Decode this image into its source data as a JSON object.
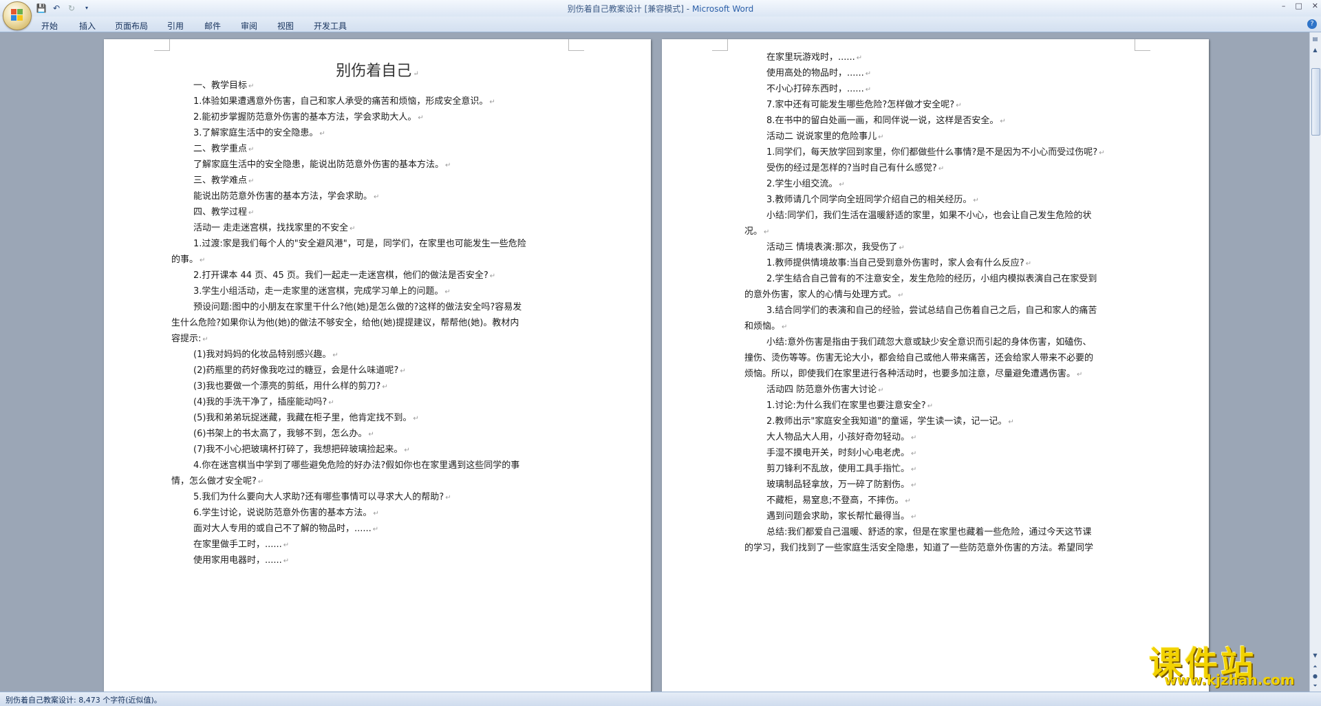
{
  "window": {
    "title": "别伤着自己教案设计 [兼容模式]",
    "title_sep": " - ",
    "app_name": "Microsoft Word"
  },
  "quick_access": {
    "save": "save-icon",
    "undo": "undo-icon",
    "redo": "redo-icon",
    "customize": "dropdown-icon"
  },
  "ribbon_tabs": [
    "开始",
    "插入",
    "页面布局",
    "引用",
    "邮件",
    "审阅",
    "视图",
    "开发工具"
  ],
  "left_page": {
    "title": "别伤着自己",
    "paragraphs": [
      "一、教学目标",
      "1.体验如果遭遇意外伤害，自己和家人承受的痛苦和烦恼，形成安全意识。",
      "2.能初步掌握防范意外伤害的基本方法，学会求助大人。",
      "3.了解家庭生活中的安全隐患。",
      "二、教学重点",
      "了解家庭生活中的安全隐患，能说出防范意外伤害的基本方法。",
      "三、教学难点",
      "能说出防范意外伤害的基本方法，学会求助。",
      "四、教学过程",
      "活动一 走走迷宫棋，找找家里的不安全",
      "1.过渡:家是我们每个人的\"安全避风港\"，可是，同学们，在家里也可能发生一些危险",
      "的事。",
      "2.打开课本 44 页、45 页。我们一起走一走迷宫棋，他们的做法是否安全?",
      "3.学生小组活动，走一走家里的迷宫棋，完成学习单上的问题。",
      "预设问题:图中的小朋友在家里干什么?他(她)是怎么做的?这样的做法安全吗?容易发",
      "生什么危险?如果你认为他(她)的做法不够安全，给他(她)提提建议，帮帮他(她)。教材内",
      "容提示:",
      "(1)我对妈妈的化妆品特别感兴趣。",
      "(2)药瓶里的药好像我吃过的糖豆，会是什么味道呢?",
      "(3)我也要做一个漂亮的剪纸，用什么样的剪刀?",
      "(4)我的手洗干净了，插座能动吗?",
      "(5)我和弟弟玩捉迷藏，我藏在柜子里，他肯定找不到。",
      "(6)书架上的书太高了，我够不到，怎么办。",
      "(7)我不小心把玻璃杯打碎了，我想把碎玻璃捡起来。",
      "4.你在迷宫棋当中学到了哪些避免危险的好办法?假如你也在家里遇到这些同学的事",
      "情，怎么做才安全呢?",
      "5.我们为什么要向大人求助?还有哪些事情可以寻求大人的帮助?",
      "6.学生讨论，说说防范意外伤害的基本方法。",
      "面对大人专用的或自己不了解的物品时，......",
      "在家里做手工时，......",
      "使用家用电器时，......"
    ]
  },
  "right_page": {
    "paragraphs": [
      "在家里玩游戏时，......",
      "使用高处的物品时，......",
      "不小心打碎东西时，......",
      "7.家中还有可能发生哪些危险?怎样做才安全呢?",
      "8.在书中的留白处画一画，和同伴说一说，这样是否安全。",
      "活动二 说说家里的危险事儿",
      "1.同学们，每天放学回到家里，你们都做些什么事情?是不是因为不小心而受过伤呢?",
      "受伤的经过是怎样的?当时自己有什么感觉?",
      "2.学生小组交流。",
      "3.教师请几个同学向全班同学介绍自己的相关经历。",
      "小结:同学们，我们生活在温暖舒适的家里，如果不小心，也会让自己发生危险的状",
      "况。",
      "活动三 情境表演:那次，我受伤了",
      "1.教师提供情境故事:当自己受到意外伤害时，家人会有什么反应?",
      "2.学生结合自己曾有的不注意安全，发生危险的经历，小组内模拟表演自己在家受到",
      "的意外伤害，家人的心情与处理方式。",
      "3.结合同学们的表演和自己的经验，尝试总结自己伤着自己之后，自己和家人的痛苦",
      "和烦恼。",
      "小结:意外伤害是指由于我们疏忽大意或缺少安全意识而引起的身体伤害，如磕伤、",
      "撞伤、烫伤等等。伤害无论大小，都会给自己或他人带来痛苦，还会给家人带来不必要的",
      "烦恼。所以，即使我们在家里进行各种活动时，也要多加注意，尽量避免遭遇伤害。",
      "活动四 防范意外伤害大讨论",
      "1.讨论:为什么我们在家里也要注意安全?",
      "2.教师出示\"家庭安全我知道\"的童谣，学生读一读，记一记。",
      "大人物品大人用，小孩好奇勿轻动。",
      "手湿不摸电开关，时刻小心电老虎。",
      "剪刀锋利不乱放，使用工具手指忙。",
      "玻璃制品轻拿放，万一碎了防割伤。",
      "不藏柜，易窒息;不登高，不摔伤。",
      "遇到问题会求助，家长帮忙最得当。",
      "总结:我们都爱自己温暖、舒适的家，但是在家里也藏着一些危险，通过今天这节课",
      "的学习，我们找到了一些家庭生活安全隐患，知道了一些防范意外伤害的方法。希望同学"
    ]
  },
  "status_bar": {
    "text": "别伤着自己教案设计: 8,473 个字符(近似值)。"
  },
  "watermark": {
    "text": "课件站",
    "url": "www.kjzhan.com"
  }
}
